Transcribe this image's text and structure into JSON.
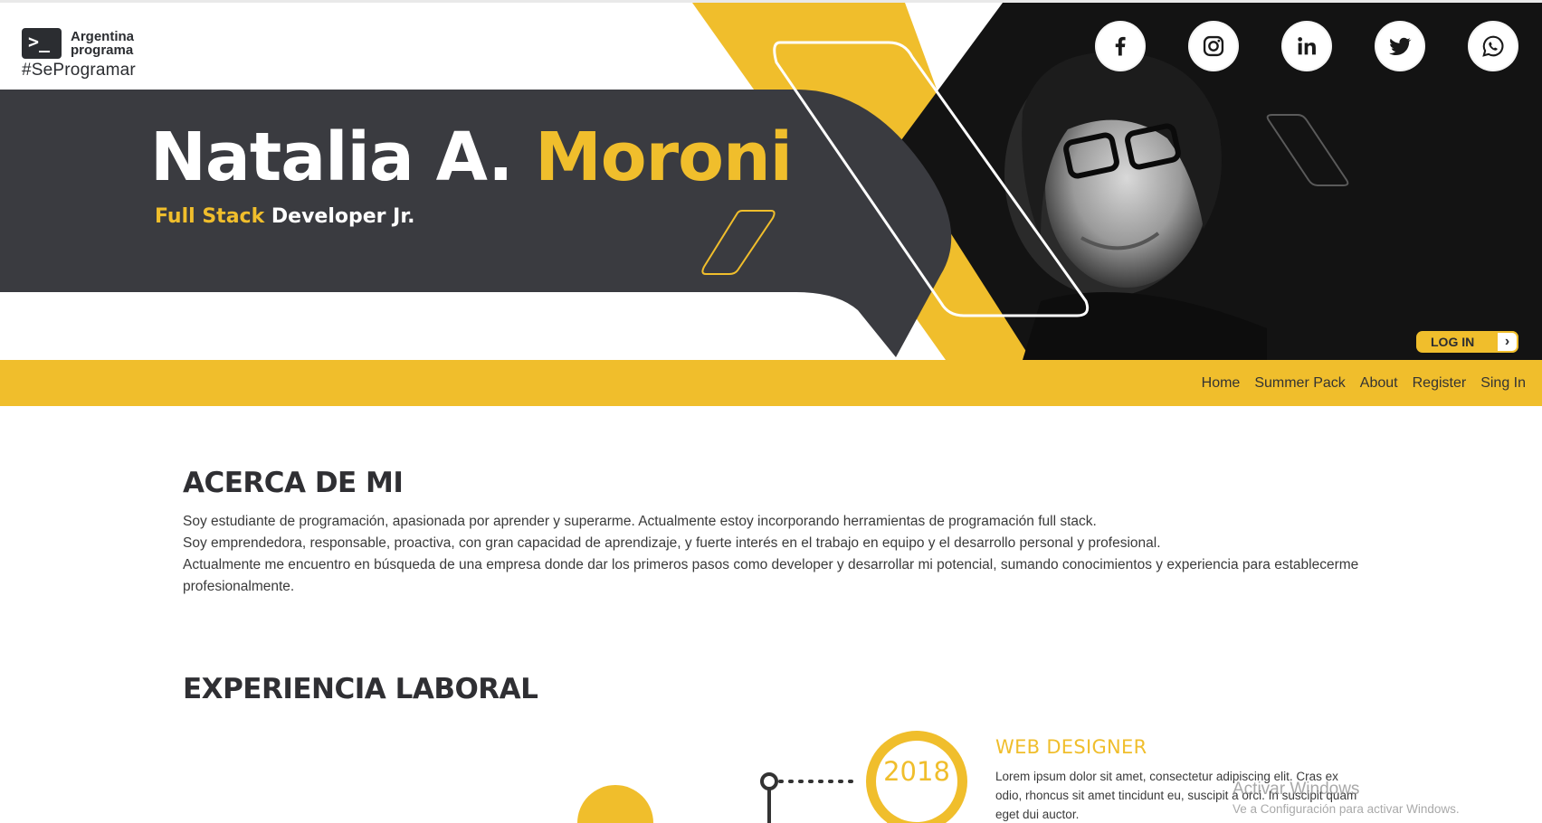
{
  "logo": {
    "line1": "Argentina",
    "line2": "programa",
    "tagline": "#SeProgramar",
    "icon": "terminal-icon",
    "icon_glyph": ">_"
  },
  "hero": {
    "first_name": "Natalia A.",
    "last_name": "Moroni",
    "role_accent": "Full Stack",
    "role_rest": "Developer Jr."
  },
  "social": [
    {
      "name": "facebook-icon"
    },
    {
      "name": "instagram-icon"
    },
    {
      "name": "linkedin-icon"
    },
    {
      "name": "twitter-icon"
    },
    {
      "name": "whatsapp-icon"
    }
  ],
  "login": {
    "label": "LOG IN",
    "arrow": "›",
    "icon": "chevron-right-icon"
  },
  "nav": {
    "items": [
      "Home",
      "Summer Pack",
      "About",
      "Register",
      "Sing In"
    ]
  },
  "about": {
    "title": "ACERCA DE MI",
    "lines": [
      "Soy estudiante de programación, apasionada por aprender y superarme. Actualmente estoy incorporando herramientas de programación full stack.",
      "Soy emprendedora, responsable, proactiva, con gran capacidad de aprendizaje, y fuerte interés en el trabajo en equipo y el desarrollo personal y profesional.",
      "Actualmente me encuentro en búsqueda de una empresa donde dar los primeros pasos como developer y desarrollar mi potencial, sumando conocimientos y experiencia para establecerme profesionalmente."
    ]
  },
  "experience": {
    "title": "EXPERIENCIA LABORAL",
    "year": "2018",
    "job_title": "WEB DESIGNER",
    "job_desc": "Lorem ipsum dolor sit amet, consectetur adipiscing elit. Cras ex odio, rhoncus sit amet tincidunt eu, suscipit a orci. In suscipit quam eget dui auctor."
  },
  "watermark": {
    "line1": "Activar Windows",
    "line2": "Ve a Configuración para activar Windows."
  },
  "colors": {
    "accent": "#f0be2c",
    "dark": "#3a3b40",
    "black": "#111111"
  }
}
